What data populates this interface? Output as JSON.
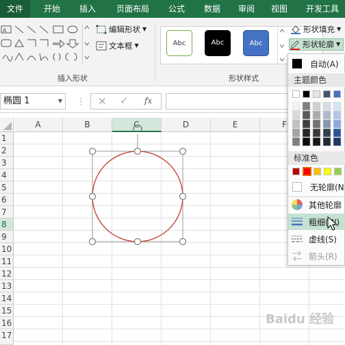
{
  "tabs": [
    "文件",
    "开始",
    "插入",
    "页面布局",
    "公式",
    "数据",
    "审阅",
    "视图",
    "开发工具"
  ],
  "ribbon": {
    "edit_shape": "编辑形状",
    "text_box": "文本框",
    "insert_shapes_group": "插入形状",
    "shape_styles_group": "形状样式",
    "style_samples": [
      "Abc",
      "Abc",
      "Abc"
    ],
    "shape_fill": "形状填充",
    "shape_outline": "形状轮廓"
  },
  "formula_bar": {
    "name_box": "椭圆 1",
    "fx": "fx"
  },
  "columns": [
    "A",
    "B",
    "C",
    "D",
    "E",
    "F"
  ],
  "selected_column": "C",
  "rows": [
    "1",
    "2",
    "3",
    "4",
    "5",
    "6",
    "7",
    "8",
    "9",
    "10",
    "11",
    "12",
    "13",
    "14",
    "15",
    "16",
    "17"
  ],
  "selected_row": "8",
  "shape": {
    "outline_color": "#c0392b",
    "handle_color": "#7a7a7a"
  },
  "outline_menu": {
    "auto": "自动(A)",
    "theme_colors": "主题颜色",
    "standard_colors": "标准色",
    "no_outline": "无轮廓(N",
    "more_colors": "其他轮廓",
    "weight": "粗细(W)",
    "dashes": "虚线(S)",
    "arrows": "箭头(R)",
    "theme_top_row": [
      "#ffffff",
      "#000000",
      "#e7e6e6",
      "#44546a",
      "#4472c4",
      "#ed7d31"
    ],
    "standard_row": [
      "#c00000",
      "#ff0000",
      "#ffc000",
      "#ffff00",
      "#92d050"
    ]
  },
  "accent_color": "#217346",
  "watermark": "Baidu 经验"
}
